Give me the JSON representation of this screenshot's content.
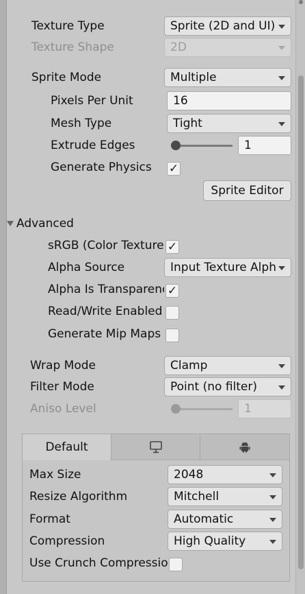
{
  "texture_type": {
    "label": "Texture Type",
    "value": "Sprite (2D and UI)"
  },
  "texture_shape": {
    "label": "Texture Shape",
    "value": "2D"
  },
  "sprite_mode": {
    "label": "Sprite Mode",
    "value": "Multiple"
  },
  "pixels_per_unit": {
    "label": "Pixels Per Unit",
    "value": "16"
  },
  "mesh_type": {
    "label": "Mesh Type",
    "value": "Tight"
  },
  "extrude_edges": {
    "label": "Extrude Edges",
    "value": "1",
    "slider_fraction": 0.03
  },
  "generate_physics": {
    "label": "Generate Physics",
    "checked": true
  },
  "sprite_editor_button": "Sprite Editor",
  "advanced": {
    "label": "Advanced",
    "srgb": {
      "label": "sRGB (Color Texture)",
      "checked": true
    },
    "alpha_source": {
      "label": "Alpha Source",
      "value": "Input Texture Alpha"
    },
    "alpha_is_transparency": {
      "label": "Alpha Is Transparency",
      "checked": true
    },
    "read_write": {
      "label": "Read/Write Enabled",
      "checked": false
    },
    "generate_mipmap": {
      "label": "Generate Mip Maps",
      "checked": false
    }
  },
  "wrap_mode": {
    "label": "Wrap Mode",
    "value": "Clamp"
  },
  "filter_mode": {
    "label": "Filter Mode",
    "value": "Point (no filter)"
  },
  "aniso_level": {
    "label": "Aniso Level",
    "value": "1"
  },
  "platform": {
    "tabs": [
      {
        "label": "Default",
        "icon": ""
      },
      {
        "label": "",
        "icon": "monitor-icon"
      },
      {
        "label": "",
        "icon": "android-icon"
      }
    ],
    "max_size": {
      "label": "Max Size",
      "value": "2048"
    },
    "resize_algorithm": {
      "label": "Resize Algorithm",
      "value": "Mitchell"
    },
    "format": {
      "label": "Format",
      "value": "Automatic"
    },
    "compression": {
      "label": "Compression",
      "value": "High Quality"
    },
    "use_crunch": {
      "label": "Use Crunch Compression",
      "checked": false
    }
  },
  "colors": {
    "panel_bg": "#c8c8c8",
    "field_bg": "#e4e4e4",
    "text": "#111111",
    "disabled_text": "#8e8e8e"
  }
}
